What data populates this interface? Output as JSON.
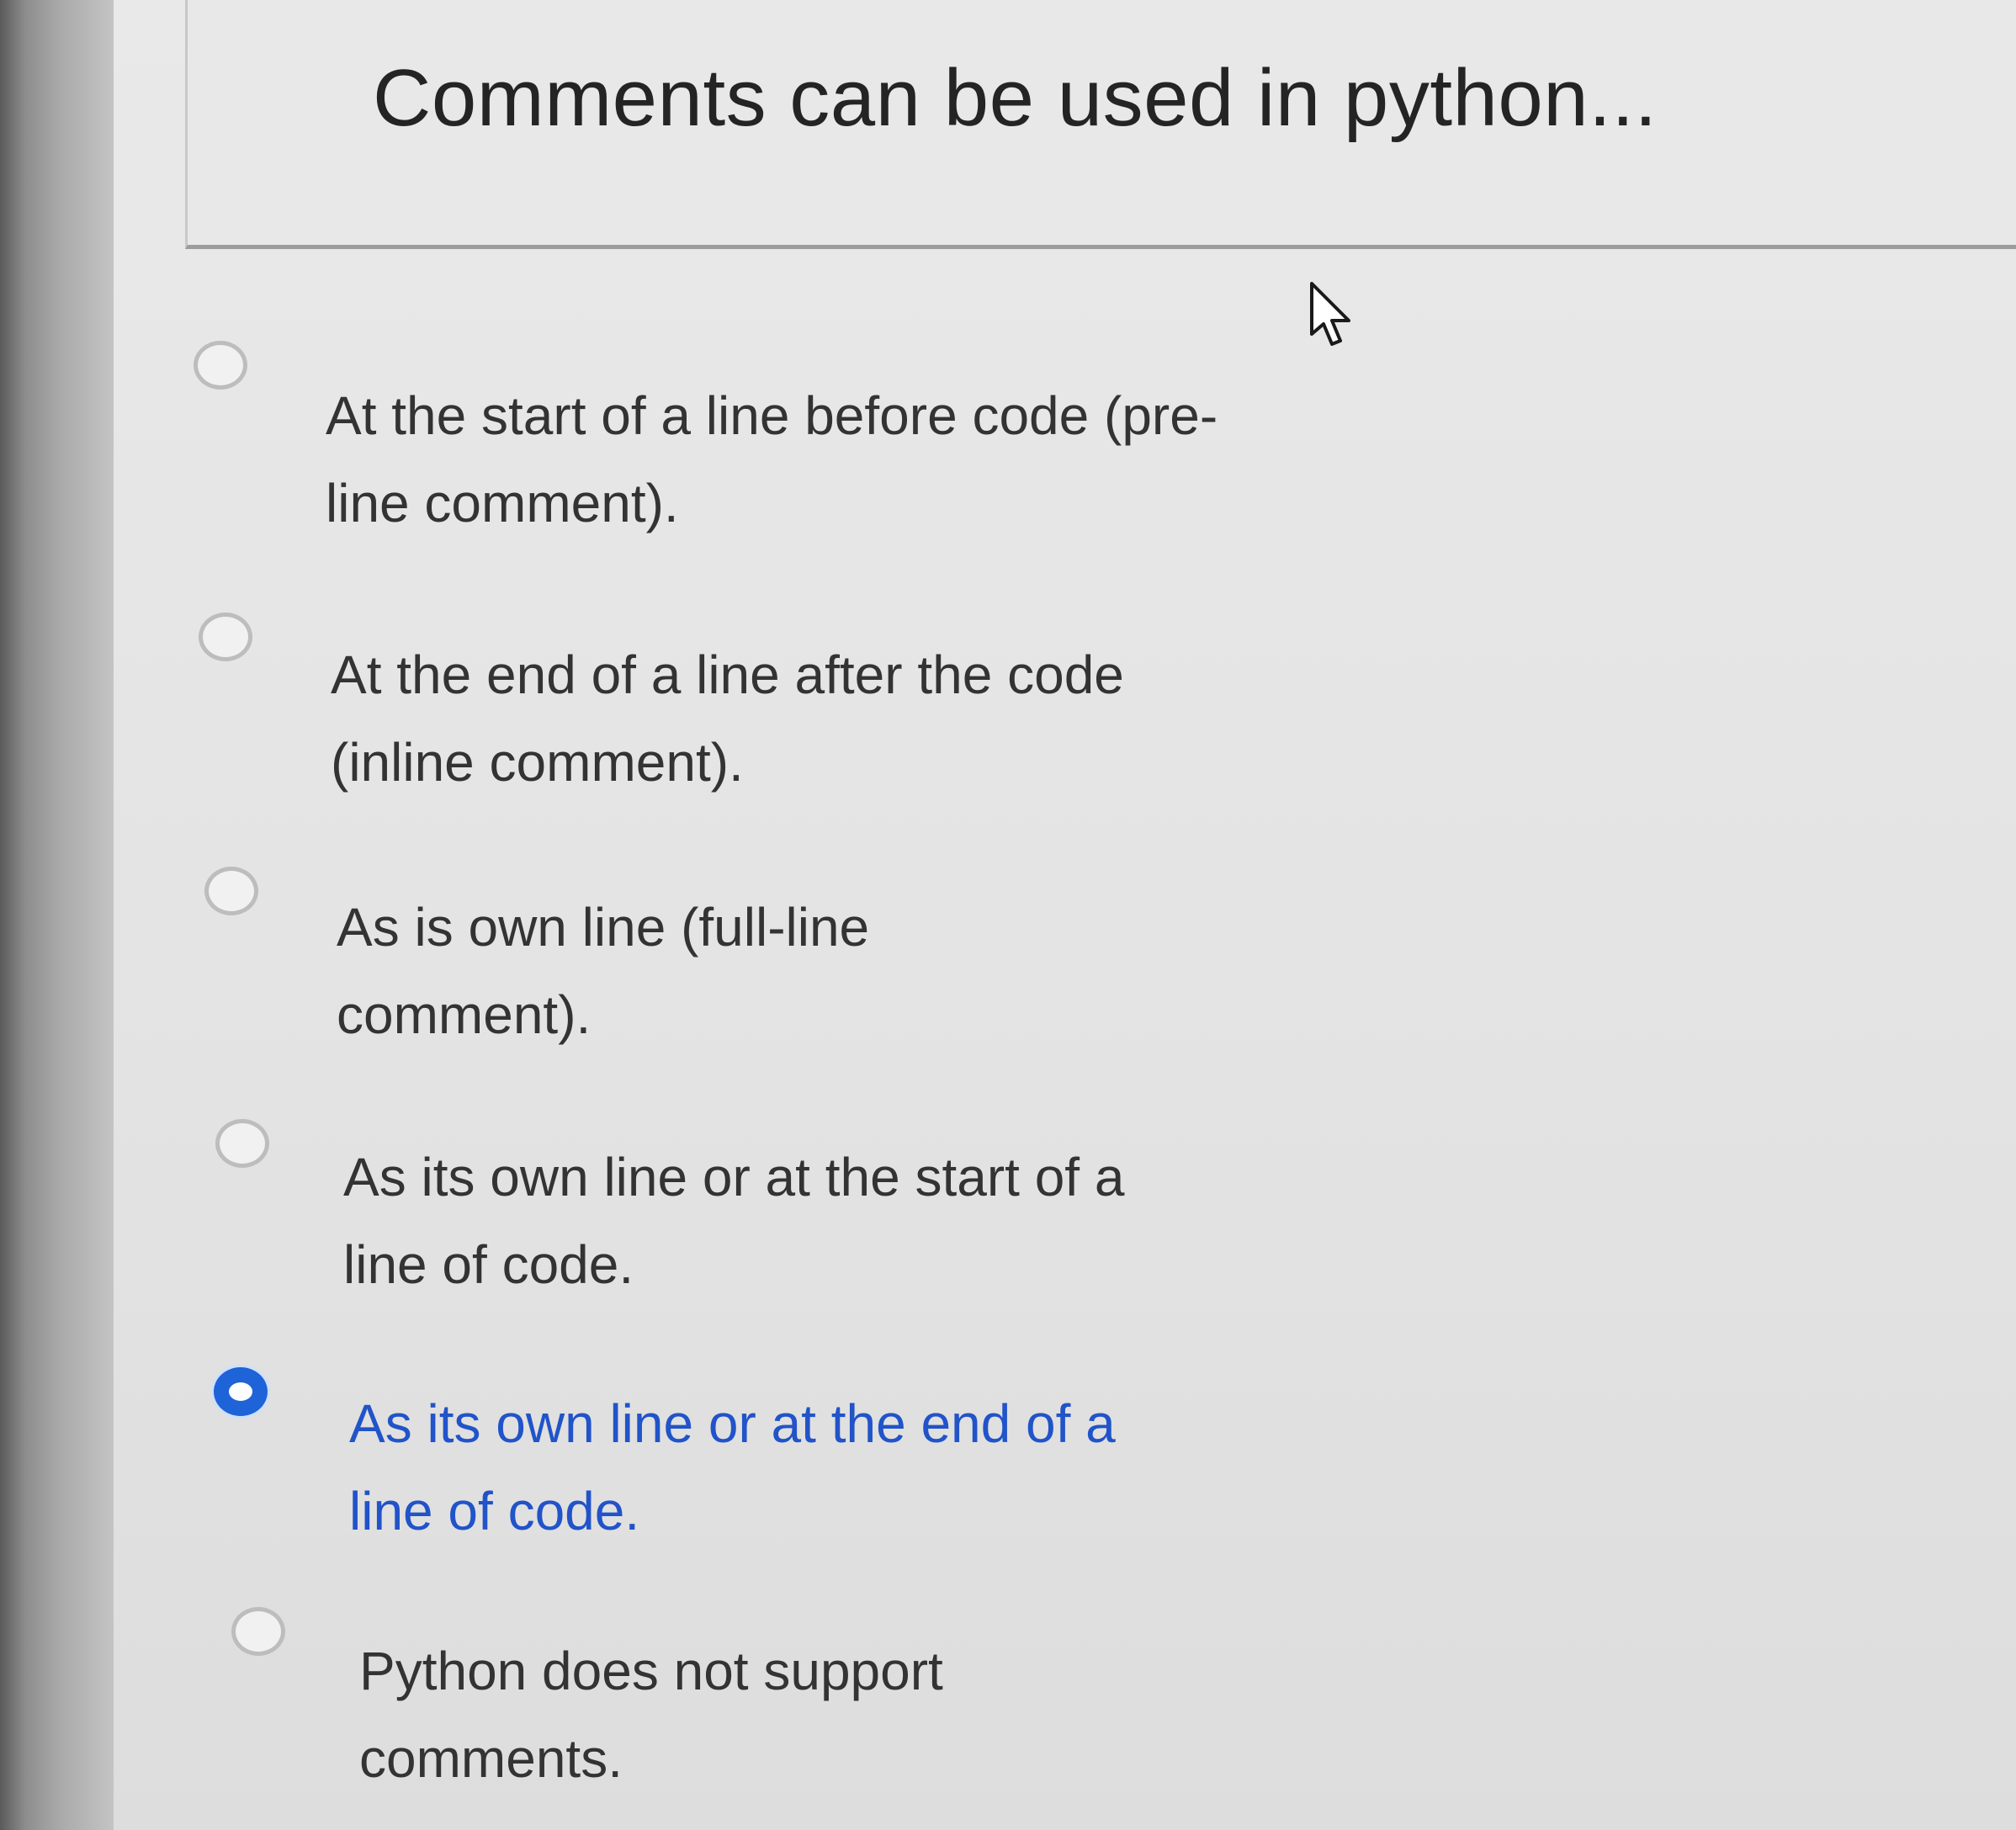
{
  "question": {
    "text": "Comments can be used in python..."
  },
  "options": [
    {
      "lines": [
        "At the start of a line before code (pre-",
        "line comment)."
      ],
      "selected": false
    },
    {
      "lines": [
        "At the end of a line after the code",
        "(inline comment)."
      ],
      "selected": false
    },
    {
      "lines": [
        "As is own line (full-line",
        "comment)."
      ],
      "selected": false
    },
    {
      "lines": [
        "As its own line or at the start of a",
        "line of code."
      ],
      "selected": false
    },
    {
      "lines": [
        "As its own line or at the end of a",
        "line of code."
      ],
      "selected": true
    },
    {
      "lines": [
        "Python does not support",
        "comments."
      ],
      "selected": false
    }
  ],
  "colors": {
    "selected_accent": "#1f63d8",
    "selected_text": "#2153c9",
    "option_text": "#333333"
  },
  "icons": {
    "cursor": "mouse-pointer-icon",
    "radio": "radio-button-icon"
  }
}
